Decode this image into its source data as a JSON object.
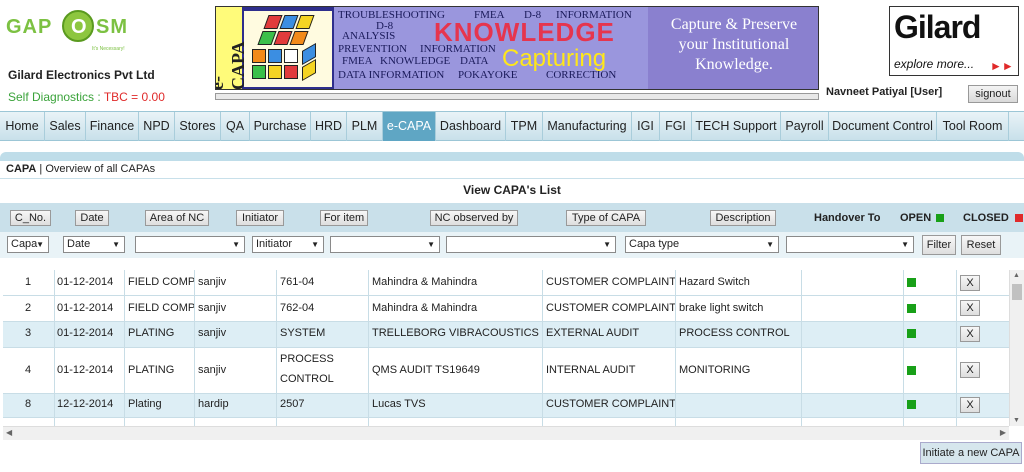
{
  "header": {
    "logo_text_left": "GAP",
    "logo_circle": "O",
    "logo_text_right": "SM",
    "logo_tagline": "It's Necessary!",
    "company_name": "Gilard Electronics Pvt Ltd",
    "self_diagnostics_label": "Self Diagnostics :",
    "tbc_value": "TBC = 0.00",
    "banner": {
      "side_label": "e-CAPA",
      "words": [
        "TROUBLESHOOTING",
        "FMEA",
        "D-8",
        "INFORMATION",
        "D-8",
        "ANALYSIS",
        "PREVENTION",
        "INFORMATION",
        "FMEA",
        "KNOWLEDGE",
        "DATA",
        "DATA INFORMATION",
        "POKAYOKE",
        "CORRECTION"
      ],
      "big_word": "KNOWLEDGE",
      "big_word2": "Capturing",
      "tagline_lines": [
        "Capture & Preserve",
        "your Institutional",
        "Knowledge."
      ]
    },
    "brand_name": "Gilard",
    "brand_tagline": "explore more...",
    "user_label": "Navneet Patiyal [User]",
    "signout_label": "signout"
  },
  "nav": {
    "items": [
      {
        "label": "Home",
        "active": false
      },
      {
        "label": "Sales",
        "active": false
      },
      {
        "label": "Finance",
        "active": false
      },
      {
        "label": "NPD",
        "active": false
      },
      {
        "label": "Stores",
        "active": false
      },
      {
        "label": "QA",
        "active": false
      },
      {
        "label": "Purchase",
        "active": false
      },
      {
        "label": "HRD",
        "active": false
      },
      {
        "label": "PLM",
        "active": false
      },
      {
        "label": "e-CAPA",
        "active": true
      },
      {
        "label": "Dashboard",
        "active": false
      },
      {
        "label": "TPM",
        "active": false
      },
      {
        "label": "Manufacturing",
        "active": false
      },
      {
        "label": "IGI",
        "active": false
      },
      {
        "label": "FGI",
        "active": false
      },
      {
        "label": "TECH Support",
        "active": false
      },
      {
        "label": "Payroll",
        "active": false
      },
      {
        "label": "Document Control",
        "active": false
      },
      {
        "label": "Tool Room",
        "active": false
      }
    ]
  },
  "breadcrumb": {
    "section": "CAPA",
    "separator": "|",
    "page": "Overview of all CAPAs"
  },
  "list_title": "View CAPA's List",
  "columns": {
    "c_no": "C_No.",
    "date": "Date",
    "area_of_nc": "Area of NC",
    "initiator": "Initiator",
    "for_item": "For item",
    "nc_observed_by": "NC observed by",
    "type_of_capa": "Type of CAPA",
    "description": "Description",
    "handover_to": "Handover To",
    "open": "OPEN",
    "closed": "CLOSED"
  },
  "filters": {
    "capa": "Capa",
    "date": "Date",
    "area": "",
    "initiator": "Initiator",
    "for_item": "",
    "nc_observed_by": "",
    "capa_type": "Capa type",
    "description": "",
    "filter_button": "Filter",
    "reset_button": "Reset"
  },
  "rows": [
    {
      "c_no": "1",
      "date": "01-12-2014",
      "area": "FIELD COMP",
      "initiator": "sanjiv",
      "item": "761-04",
      "observed_by": "Mahindra & Mahindra",
      "type": "CUSTOMER COMPLAINT",
      "description": "Hazard Switch",
      "handover": "",
      "close_label": "X"
    },
    {
      "c_no": "2",
      "date": "01-12-2014",
      "area": "FIELD COMP",
      "initiator": "sanjiv",
      "item": "762-04",
      "observed_by": "Mahindra & Mahindra",
      "type": "CUSTOMER COMPLAINT",
      "description": "brake light switch",
      "handover": "",
      "close_label": "X"
    },
    {
      "c_no": "3",
      "date": "01-12-2014",
      "area": "PLATING",
      "initiator": "sanjiv",
      "item": "SYSTEM",
      "observed_by": "TRELLEBORG VIBRACOUSTICS",
      "type": "EXTERNAL AUDIT",
      "description": "PROCESS CONTROL",
      "handover": "",
      "close_label": "X"
    },
    {
      "c_no": "4",
      "date": "01-12-2014",
      "area": "PLATING",
      "initiator": "sanjiv",
      "item": "PROCESS CONTROL",
      "observed_by": "QMS AUDIT TS19649",
      "type": "INTERNAL AUDIT",
      "description": "MONITORING",
      "handover": "",
      "close_label": "X"
    },
    {
      "c_no": "8",
      "date": "12-12-2014",
      "area": "Plating",
      "initiator": "hardip",
      "item": "2507",
      "observed_by": "Lucas TVS",
      "type": "CUSTOMER COMPLAINT",
      "description": "",
      "handover": "",
      "close_label": "X"
    }
  ],
  "initiate_button": "Initiate a new CAPA",
  "colors": {
    "nav_bg": "#c8e0ea",
    "nav_active": "#5fa6c4",
    "open_marker": "#18a018",
    "closed_marker": "#e02a2a",
    "row_alt": "#ddeef5"
  }
}
